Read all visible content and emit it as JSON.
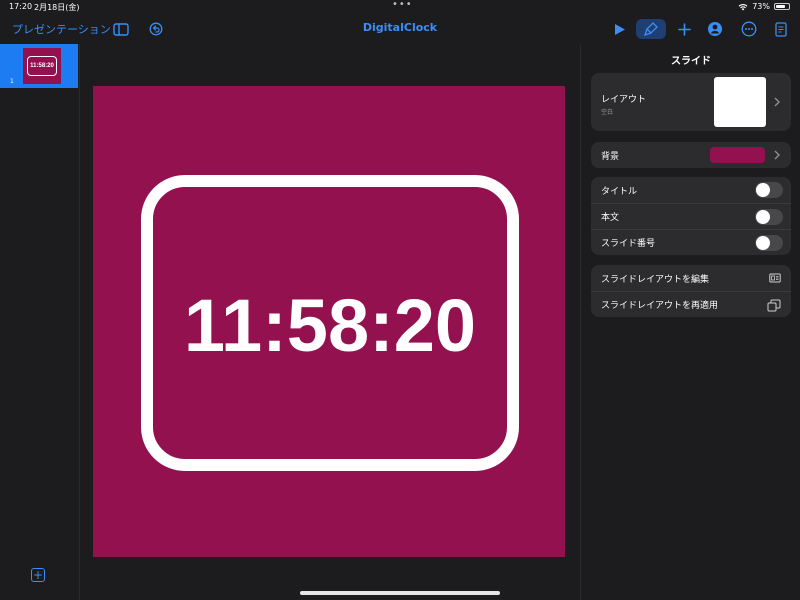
{
  "status_bar": {
    "time": "17:20",
    "date": "2月18日(金)",
    "battery": "73%",
    "battery_level": 0.73
  },
  "toolbar": {
    "back_label": "プレゼンテーション",
    "document_title": "DigitalClock"
  },
  "navigator": {
    "slides": [
      {
        "number": "1",
        "thumbnail_text": "11:58:20"
      }
    ]
  },
  "slide": {
    "clock_text": "11:58:20",
    "background_color": "#941150"
  },
  "inspector": {
    "title": "スライド",
    "layout_label": "レイアウト",
    "layout_value": "空白",
    "background_label": "背景",
    "toggles": [
      {
        "label": "タイトル",
        "on": false
      },
      {
        "label": "本文",
        "on": false
      },
      {
        "label": "スライド番号",
        "on": false
      }
    ],
    "actions": [
      {
        "label": "スライドレイアウトを編集",
        "icon": "layout-edit-icon"
      },
      {
        "label": "スライドレイアウトを再適用",
        "icon": "reapply-layout-icon"
      }
    ]
  },
  "colors": {
    "accent": "#3a8ef6",
    "slide_bg": "#941150",
    "panel": "#2c2c2e"
  }
}
